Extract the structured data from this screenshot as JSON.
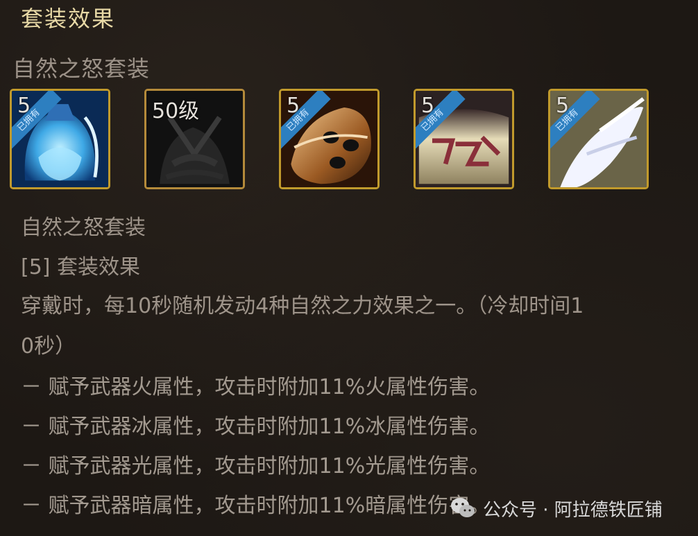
{
  "panel": {
    "title": "套装效果",
    "set_name": "自然之怒套装"
  },
  "slots": [
    {
      "level": "5",
      "owned": true,
      "ribbon": "已拥有",
      "icon": "blue-armor-icon"
    },
    {
      "level": "50级",
      "owned": false,
      "ribbon": "",
      "icon": "dark-armor-icon"
    },
    {
      "level": "5",
      "owned": true,
      "ribbon": "已拥有",
      "icon": "bronze-belt-icon"
    },
    {
      "level": "5",
      "owned": true,
      "ribbon": "已拥有",
      "icon": "boots-icon"
    },
    {
      "level": "5",
      "owned": true,
      "ribbon": "已拥有",
      "icon": "white-gloves-icon"
    }
  ],
  "effect": {
    "set_name": "自然之怒套装",
    "tier": "[5] 套装效果",
    "desc_line1": "穿戴时，每10秒随机发动4种自然之力效果之一。（冷却时间1",
    "desc_line2": "0秒）",
    "bullets": [
      "－ 赋予武器火属性，攻击时附加11%火属性伤害。",
      "－ 赋予武器冰属性，攻击时附加11%冰属性伤害。",
      "－ 赋予武器光属性，攻击时附加11%光属性伤害。",
      "－ 赋予武器暗属性，攻击时附加11%暗属性伤害。"
    ]
  },
  "watermark": {
    "text": "公众号 · 阿拉德铁匠铺",
    "icon": "wechat-icon"
  }
}
